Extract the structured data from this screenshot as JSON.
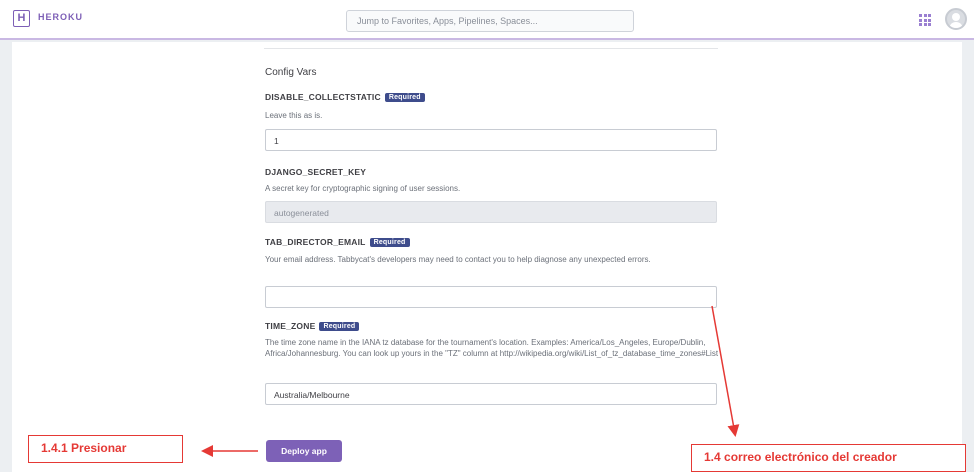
{
  "topbar": {
    "logo_letter": "H",
    "brand": "HEROKU",
    "search_placeholder": "Jump to Favorites, Apps, Pipelines, Spaces..."
  },
  "form": {
    "section_title": "Config Vars",
    "required_badge": "Required",
    "vars": [
      {
        "name": "DISABLE_COLLECTSTATIC",
        "required": true,
        "description": "Leave this as is.",
        "value": "1"
      },
      {
        "name": "DJANGO_SECRET_KEY",
        "required": false,
        "description": "A secret key for cryptographic signing of user sessions.",
        "value": "autogenerated"
      },
      {
        "name": "TAB_DIRECTOR_EMAIL",
        "required": true,
        "description": "Your email address. Tabbycat's developers may need to contact you to help diagnose any unexpected errors.",
        "value": ""
      },
      {
        "name": "TIME_ZONE",
        "required": true,
        "description": "The time zone name in the IANA tz database for the tournament's location. Examples: America/Los_Angeles, Europe/Dublin, Africa/Johannesburg. You can look up yours in the \"TZ\" column at http://wikipedia.org/wiki/List_of_tz_database_time_zones#List",
        "value": "Australia/Melbourne"
      }
    ],
    "deploy_label": "Deploy app"
  },
  "annotations": {
    "press_label": "1.4.1 Presionar",
    "email_label": "1.4 correo electrónico del creador",
    "color": "#e53935"
  }
}
